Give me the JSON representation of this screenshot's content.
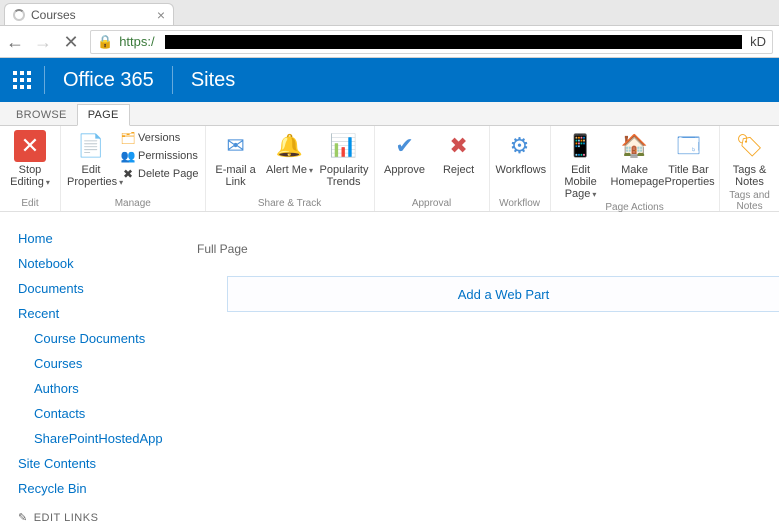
{
  "browser": {
    "tab_title": "Courses",
    "url_scheme": "https:/",
    "url_tail": "kD"
  },
  "suite": {
    "brand": "Office 365",
    "site": "Sites"
  },
  "ribbon_tabs": {
    "browse": "BROWSE",
    "page": "PAGE"
  },
  "ribbon": {
    "edit": {
      "stop_editing": "Stop Editing",
      "group": "Edit"
    },
    "manage": {
      "edit_properties": "Edit Properties",
      "versions": "Versions",
      "permissions": "Permissions",
      "delete_page": "Delete Page",
      "group": "Manage"
    },
    "share": {
      "email_link": "E-mail a Link",
      "alert_me": "Alert Me",
      "popularity": "Popularity Trends",
      "group": "Share & Track"
    },
    "approval": {
      "approve": "Approve",
      "reject": "Reject",
      "group": "Approval"
    },
    "workflow": {
      "workflows": "Workflows",
      "group": "Workflow"
    },
    "page_actions": {
      "edit_mobile": "Edit Mobile Page",
      "make_homepage": "Make Homepage",
      "titlebar": "Title Bar Properties",
      "group": "Page Actions"
    },
    "tags": {
      "tags_notes": "Tags & Notes",
      "group": "Tags and Notes"
    }
  },
  "nav": {
    "home": "Home",
    "notebook": "Notebook",
    "documents": "Documents",
    "recent": "Recent",
    "recent_items": {
      "course_docs": "Course Documents",
      "courses": "Courses",
      "authors": "Authors",
      "contacts": "Contacts",
      "app": "SharePointHostedApp"
    },
    "site_contents": "Site Contents",
    "recycle": "Recycle Bin",
    "edit_links": "EDIT LINKS"
  },
  "content": {
    "zone_label": "Full Page",
    "add_webpart": "Add a Web Part"
  }
}
